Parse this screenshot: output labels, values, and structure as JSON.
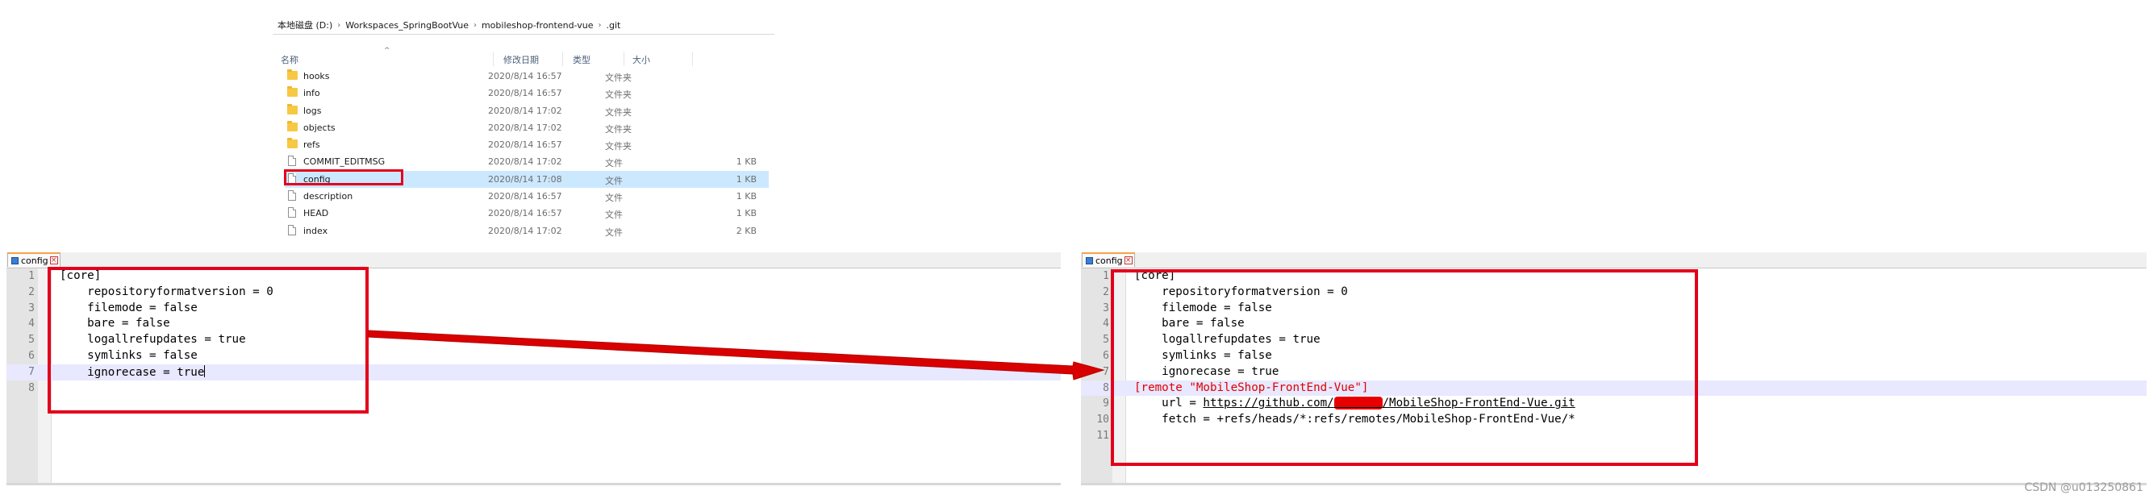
{
  "explorer": {
    "breadcrumb": [
      "本地磁盘 (D:)",
      "Workspaces_SpringBootVue",
      "mobileshop-frontend-vue",
      ".git"
    ],
    "columns": {
      "name": "名称",
      "date": "修改日期",
      "type": "类型",
      "size": "大小"
    },
    "files": [
      {
        "name": "hooks",
        "date": "2020/8/14 16:57",
        "type": "文件夹",
        "size": "",
        "icon": "folder-icon"
      },
      {
        "name": "info",
        "date": "2020/8/14 16:57",
        "type": "文件夹",
        "size": "",
        "icon": "folder-icon"
      },
      {
        "name": "logs",
        "date": "2020/8/14 17:02",
        "type": "文件夹",
        "size": "",
        "icon": "folder-icon"
      },
      {
        "name": "objects",
        "date": "2020/8/14 17:02",
        "type": "文件夹",
        "size": "",
        "icon": "folder-icon"
      },
      {
        "name": "refs",
        "date": "2020/8/14 16:57",
        "type": "文件夹",
        "size": "",
        "icon": "folder-icon"
      },
      {
        "name": "COMMIT_EDITMSG",
        "date": "2020/8/14 17:02",
        "type": "文件",
        "size": "1 KB",
        "icon": "file-icon"
      },
      {
        "name": "config",
        "date": "2020/8/14 17:08",
        "type": "文件",
        "size": "1 KB",
        "icon": "file-icon",
        "selected": true
      },
      {
        "name": "description",
        "date": "2020/8/14 16:57",
        "type": "文件",
        "size": "1 KB",
        "icon": "file-icon"
      },
      {
        "name": "HEAD",
        "date": "2020/8/14 16:57",
        "type": "文件",
        "size": "1 KB",
        "icon": "file-icon"
      },
      {
        "name": "index",
        "date": "2020/8/14 17:02",
        "type": "文件",
        "size": "2 KB",
        "icon": "file-icon"
      }
    ]
  },
  "editor_before": {
    "tab_label": "config",
    "lines": [
      {
        "num": "1",
        "text": "[core]"
      },
      {
        "num": "2",
        "text": "    repositoryformatversion = 0"
      },
      {
        "num": "3",
        "text": "    filemode = false"
      },
      {
        "num": "4",
        "text": "    bare = false"
      },
      {
        "num": "5",
        "text": "    logallrefupdates = true"
      },
      {
        "num": "6",
        "text": "    symlinks = false"
      },
      {
        "num": "7",
        "text": "    ignorecase = true",
        "current": true,
        "cursor": true
      },
      {
        "num": "8",
        "text": ""
      }
    ]
  },
  "editor_after": {
    "tab_label": "config",
    "lines": [
      {
        "num": "1",
        "text": "[core]"
      },
      {
        "num": "2",
        "text": "    repositoryformatversion = 0"
      },
      {
        "num": "3",
        "text": "    filemode = false"
      },
      {
        "num": "4",
        "text": "    bare = false"
      },
      {
        "num": "5",
        "text": "    logallrefupdates = true"
      },
      {
        "num": "6",
        "text": "    symlinks = false"
      },
      {
        "num": "7",
        "text": "    ignorecase = true"
      },
      {
        "num": "8",
        "text": "[remote \"MobileShop-FrontEnd-Vue\"]",
        "current": true,
        "style": "red"
      },
      {
        "num": "9",
        "text": "    url = ",
        "url_prefix": "https://github.com/",
        "url_redacted": "xxxxxxx",
        "url_suffix": "/MobileShop-FrontEnd-Vue.git"
      },
      {
        "num": "10",
        "text": "    fetch = +refs/heads/*:refs/remotes/MobileShop-FrontEnd-Vue/*"
      },
      {
        "num": "11",
        "text": ""
      }
    ]
  },
  "colors": {
    "annotation_red": "#e3001b",
    "selection_blue": "#cce8ff",
    "current_line": "#e8e8ff"
  },
  "watermark": "CSDN @u013250861"
}
